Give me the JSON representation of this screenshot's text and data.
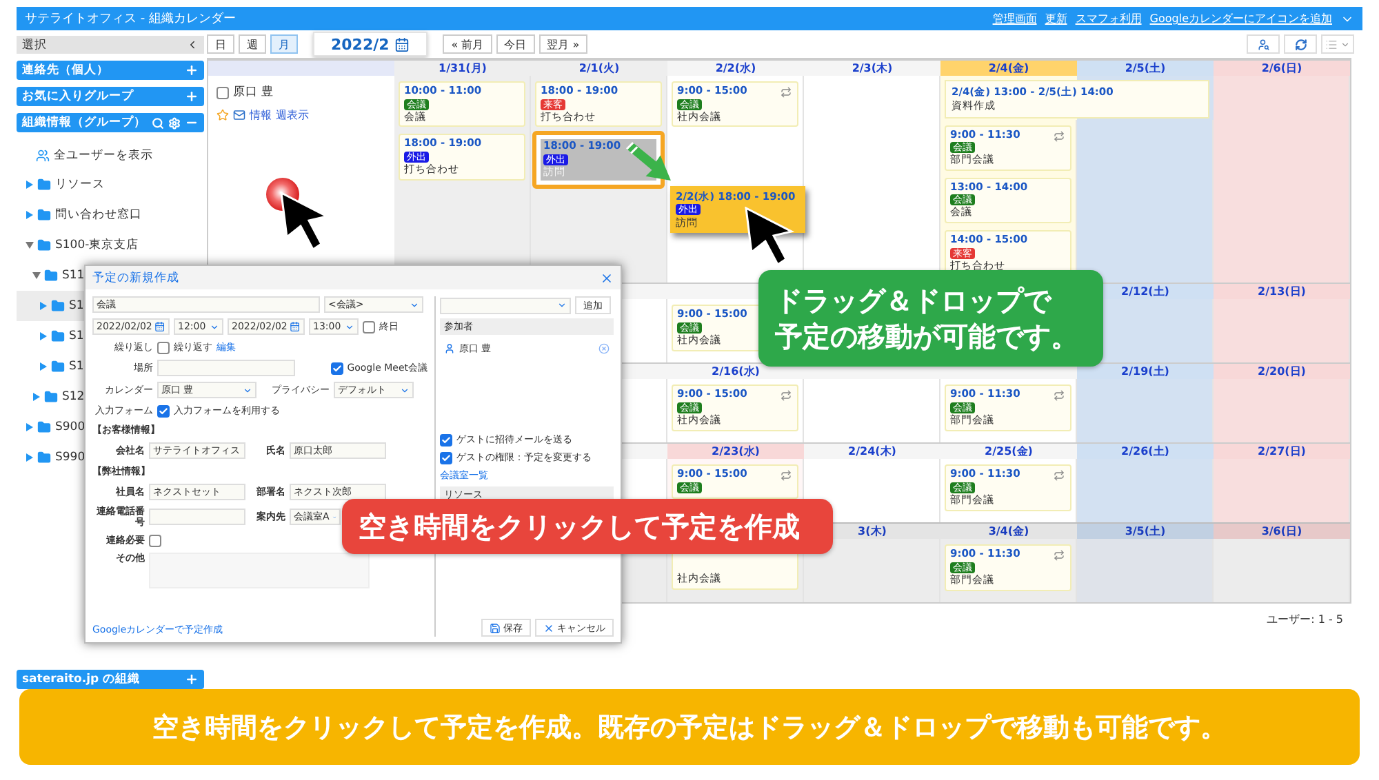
{
  "app_bar": {
    "title": "サテライトオフィス - 組織カレンダー",
    "links": [
      "管理画面",
      "更新",
      "スマフォ利用",
      "Googleカレンダーにアイコンを追加"
    ]
  },
  "sidebar": {
    "header": "選択",
    "sections": [
      {
        "label": "連絡先（個人）",
        "kind": "add"
      },
      {
        "label": "お気に入りグループ",
        "kind": "add"
      },
      {
        "label": "組織情報（グループ）",
        "kind": "tools"
      }
    ],
    "all_users": "全ユーザーを表示",
    "tree": [
      {
        "label": "リソース",
        "expanded": false,
        "selected": false
      },
      {
        "label": "問い合わせ窓口",
        "expanded": false,
        "selected": false
      },
      {
        "label": "S100-東京支店",
        "expanded": true,
        "selected": false,
        "children": [
          {
            "label": "S11",
            "expanded": true,
            "selected": false,
            "children": [
              {
                "label": "S1",
                "expanded": false,
                "selected": true
              },
              {
                "label": "S1",
                "expanded": false,
                "selected": false
              },
              {
                "label": "S1",
                "expanded": false,
                "selected": false
              }
            ]
          },
          {
            "label": "S12",
            "expanded": false,
            "selected": false
          }
        ]
      },
      {
        "label": "S900",
        "expanded": false,
        "selected": false
      },
      {
        "label": "S990",
        "expanded": false,
        "selected": false
      }
    ],
    "bottom_section": "sateraito.jp の組織"
  },
  "toolbar": {
    "views": [
      {
        "label": "日",
        "selected": false
      },
      {
        "label": "週",
        "selected": false
      },
      {
        "label": "月",
        "selected": true
      }
    ],
    "month": "2022/2",
    "nav": [
      "« 前月",
      "今日",
      "翌月 »"
    ]
  },
  "calendar": {
    "user": {
      "name": "原口 豊",
      "checked": false,
      "links": [
        "情報",
        "週表示"
      ]
    },
    "weeks": [
      {
        "next_month": false,
        "days": [
          {
            "label": "1/31(月)",
            "kind": "past",
            "events": [
              {
                "time": "10:00 - 11:00",
                "tag": "会議",
                "color": "#1e7e1e",
                "title": "会議",
                "repeat": false,
                "kind": "normal"
              },
              {
                "time": "18:00 - 19:00",
                "tag": "外出",
                "color": "#1a1ae6",
                "title": "打ち合わせ",
                "repeat": false,
                "kind": "normal"
              }
            ]
          },
          {
            "label": "2/1(火)",
            "kind": "past",
            "events": [
              {
                "time": "18:00 - 19:00",
                "tag": "来客",
                "color": "#e53935",
                "title": "打ち合わせ",
                "repeat": false,
                "kind": "normal"
              },
              {
                "time": "18:00 - 19:00",
                "tag": "外出",
                "color": "#1a1ae6",
                "title": "訪問",
                "repeat": false,
                "kind": "drag_source"
              }
            ]
          },
          {
            "label": "2/2(水)",
            "kind": "weekday",
            "events": [
              {
                "time": "9:00 - 15:00",
                "tag": "会議",
                "color": "#1e7e1e",
                "title": "社内会議",
                "repeat": true,
                "kind": "normal"
              }
            ]
          },
          {
            "label": "2/3(木)",
            "kind": "weekday"
          },
          {
            "label": "2/4(金)",
            "kind": "today",
            "banner": {
              "time": "2/4(金) 13:00 - 2/5(土) 14:00",
              "title": "資料作成",
              "kind": "two_day"
            },
            "events": [
              {
                "time": "9:00 - 11:30",
                "tag": "会議",
                "color": "#1e7e1e",
                "title": "部門会議",
                "repeat": true,
                "kind": "normal"
              },
              {
                "time": "13:00 - 14:00",
                "tag": "会議",
                "color": "#1e7e1e",
                "title": "会議",
                "repeat": false,
                "kind": "normal"
              },
              {
                "time": "14:00 - 15:00",
                "tag": "来客",
                "color": "#e53935",
                "title": "打ち合わせ",
                "repeat": false,
                "kind": "normal"
              }
            ]
          },
          {
            "label": "2/5(土)",
            "kind": "sat"
          },
          {
            "label": "2/6(日)",
            "kind": "sun"
          }
        ]
      },
      {
        "next_month": false,
        "days": [
          {
            "kind": "weekday"
          },
          {
            "kind": "weekday"
          },
          {
            "kind": "weekday",
            "events": [
              {
                "time": "9:00 - 15:00",
                "tag": "会議",
                "color": "#1e7e1e",
                "title": "社内会議",
                "repeat": false,
                "kind": "normal"
              }
            ]
          },
          {
            "kind": "weekday"
          },
          {
            "kind": "weekday"
          },
          {
            "label": "2/12(土)",
            "kind": "sat"
          },
          {
            "label": "2/13(日)",
            "kind": "sun"
          }
        ]
      },
      {
        "next_month": false,
        "days": [
          {
            "kind": "weekday"
          },
          {
            "kind": "weekday"
          },
          {
            "label": "2/16(水)",
            "kind": "weekday",
            "events": [
              {
                "time": "9:00 - 15:00",
                "tag": "会議",
                "color": "#1e7e1e",
                "title": "社内会議",
                "repeat": true,
                "kind": "normal"
              }
            ]
          },
          {
            "kind": "weekday"
          },
          {
            "kind": "weekday",
            "events": [
              {
                "time": "9:00 - 11:30",
                "tag": "会議",
                "color": "#1e7e1e",
                "title": "部門会議",
                "repeat": true,
                "kind": "normal"
              }
            ]
          },
          {
            "label": "2/19(土)",
            "kind": "sat"
          },
          {
            "label": "2/20(日)",
            "kind": "sun"
          }
        ]
      },
      {
        "next_month": false,
        "days": [
          {
            "kind": "weekday"
          },
          {
            "kind": "weekday"
          },
          {
            "label": "2/23(水)",
            "kind": "holiday",
            "events": [
              {
                "time": "9:00 - 15:00",
                "tag": "会議",
                "color": "#1e7e1e",
                "repeat": true,
                "kind": "normal"
              }
            ]
          },
          {
            "label": "2/24(木)",
            "kind": "weekday"
          },
          {
            "label": "2/25(金)",
            "kind": "weekday",
            "events": [
              {
                "time": "9:00 - 11:30",
                "tag": "会議",
                "color": "#1e7e1e",
                "title": "部門会議",
                "repeat": true,
                "kind": "normal"
              }
            ]
          },
          {
            "label": "2/26(土)",
            "kind": "sat"
          },
          {
            "label": "2/27(日)",
            "kind": "sun"
          }
        ]
      },
      {
        "next_month": true,
        "days": [
          {
            "kind": "weekday"
          },
          {
            "kind": "weekday"
          },
          {
            "kind": "weekday",
            "events": [
              {
                "title": "社内会議",
                "kind": "normal"
              }
            ]
          },
          {
            "label": "3(木)",
            "kind": "weekday"
          },
          {
            "label": "3/4(金)",
            "kind": "weekday",
            "events": [
              {
                "time": "9:00 - 11:30",
                "tag": "会議",
                "color": "#1e7e1e",
                "title": "部門会議",
                "repeat": true,
                "kind": "normal"
              }
            ]
          },
          {
            "label": "3/5(土)",
            "kind": "sat"
          },
          {
            "label": "3/6(日)",
            "kind": "sun"
          }
        ]
      }
    ],
    "dragging": {
      "time": "2/2(水) 18:00 - 19:00",
      "tag": "外出",
      "color": "#1a1ae6",
      "title": "訪問"
    },
    "footer": "ユーザー: 1 - 5"
  },
  "dialog": {
    "title": "予定の新規作成",
    "subject": "会議",
    "category": "<会議>",
    "start_date": "2022/02/02",
    "start_time": "12:00",
    "end_date": "2022/02/02",
    "end_time": "13:00",
    "all_day": {
      "label": "終日",
      "checked": false
    },
    "repeat": {
      "label": "繰り返し",
      "option": "繰り返す",
      "checked": false,
      "link": "編集"
    },
    "place_label": "場所",
    "meet": {
      "label": "Google Meet会議",
      "checked": true
    },
    "calendar_label": "カレンダー",
    "calendar": "原口 豊",
    "privacy_label": "プライバシー",
    "privacy": "デフォルト",
    "form": {
      "label": "入力フォーム",
      "option": "入力フォームを利用する",
      "checked": true
    },
    "form_rows": [
      {
        "kind": "heading",
        "text": "【お客様情報】"
      },
      {
        "kind": "pair",
        "fields": [
          {
            "label": "会社名",
            "value": "サテライトオフィス"
          },
          {
            "label": "氏名",
            "value": "原口太郎"
          }
        ]
      },
      {
        "kind": "heading",
        "text": "【弊社情報】"
      },
      {
        "kind": "pair",
        "fields": [
          {
            "label": "社員名",
            "value": "ネクストセット"
          },
          {
            "label": "部署名",
            "value": "ネクスト次郎"
          }
        ]
      },
      {
        "kind": "pair",
        "fields": [
          {
            "label": "連絡電話番号"
          },
          {
            "label": "案内先",
            "select": "会議室A"
          }
        ]
      },
      {
        "kind": "check",
        "label": "連絡必要",
        "checked": false
      },
      {
        "kind": "textarea",
        "label": "その他"
      }
    ],
    "google_link": "Googleカレンダーで予定作成",
    "add_button": "追加",
    "participants_header": "参加者",
    "participants": [
      "原口 豊"
    ],
    "guest_options": [
      {
        "label": "ゲストに招待メールを送る",
        "checked": true
      },
      {
        "label": "ゲストの権限：予定を変更する",
        "checked": true
      }
    ],
    "rooms_link": "会議室一覧",
    "resources_header": "リソース",
    "buttons": [
      {
        "label": "保存",
        "kind": "save"
      },
      {
        "label": "キャンセル",
        "kind": "cancel"
      }
    ]
  },
  "callouts": [
    {
      "kind": "drag",
      "lines": [
        "ドラッグ＆ドロップで",
        "予定の移動が可能です。"
      ]
    },
    {
      "kind": "click",
      "lines": [
        "空き時間をクリックして予定を作成"
      ]
    }
  ],
  "banner": "空き時間をクリックして予定を作成。既存の予定はドラッグ＆ドロップで移動も可能です。"
}
